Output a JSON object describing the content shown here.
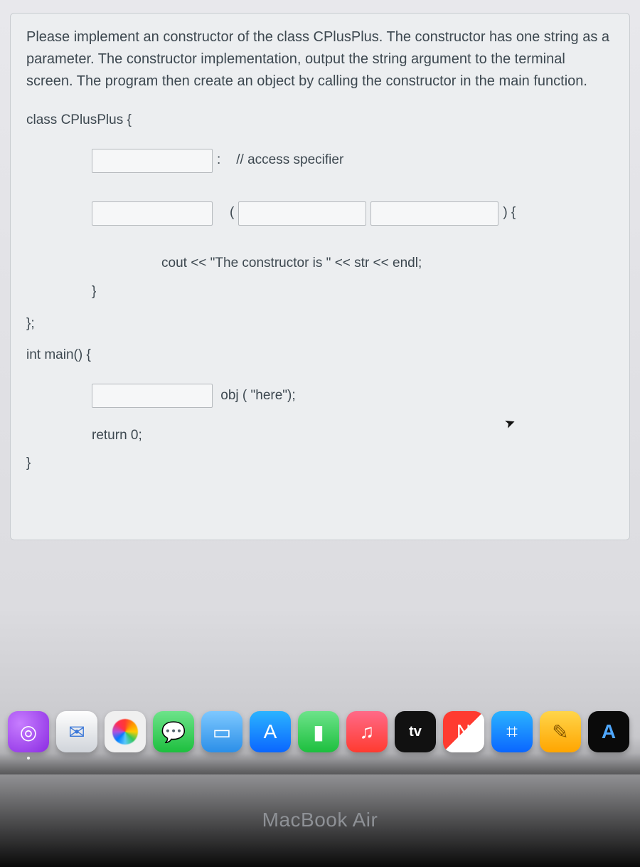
{
  "question": {
    "prompt": "Please implement an constructor of the class CPlusPlus. The constructor has one string as a parameter. The constructor implementation, output the string argument to the terminal screen. The program then create an object by calling the constructor in the main function.",
    "class_decl": "class CPlusPlus {",
    "colon": ":",
    "access_comment": "// access specifier",
    "open_paren": "(",
    "close_sig": ") {",
    "cout_line": "cout << \"The constructor is \" << str << endl;",
    "close_brace": "}",
    "close_class": "};",
    "main_sig": "int main() {",
    "obj_call": " obj ( \"here\");",
    "return_stmt": "return 0;"
  },
  "dock": {
    "podcasts": "◎",
    "mail": "✉",
    "messages": "💬",
    "appstore": "A",
    "music": "♫",
    "tv": "tv",
    "news": "N",
    "keynote": "⌗",
    "notes": "✎",
    "xcode": "A"
  },
  "hardware": {
    "label": "MacBook Air"
  }
}
